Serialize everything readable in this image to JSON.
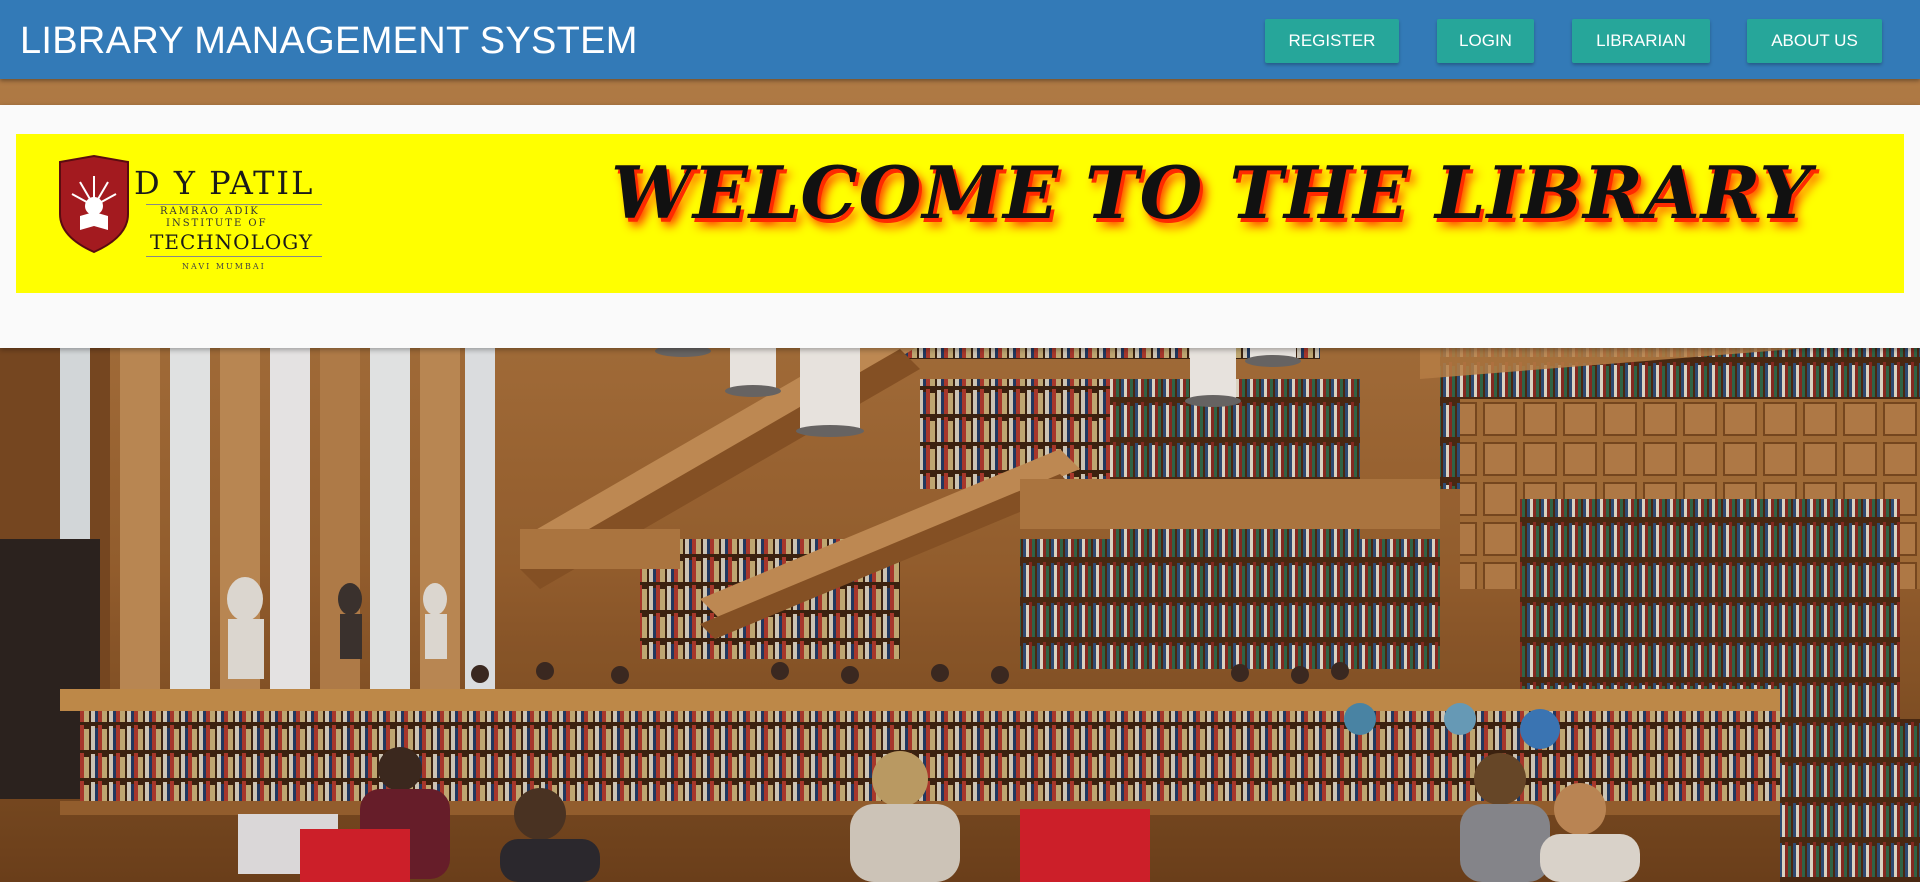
{
  "navbar": {
    "title": "LIBRARY MANAGEMENT SYSTEM",
    "buttons": {
      "register": "REGISTER",
      "login": "LOGIN",
      "librarian": "LIBRARIAN",
      "about": "ABOUT US"
    },
    "bg_color": "#337ab7",
    "button_color": "#26a69a"
  },
  "banner": {
    "bg_color": "#ffff00",
    "welcome_text": "WELCOME TO THE LIBRARY",
    "logo": {
      "name": "D Y PATIL",
      "line1": "RAMRAO ADIK",
      "line2": "INSTITUTE OF",
      "line3": "TECHNOLOGY",
      "line4": "NAVI MUMBAI",
      "shield_color": "#a31a1f"
    }
  },
  "background": {
    "description_icon": "library-hall-photo"
  }
}
